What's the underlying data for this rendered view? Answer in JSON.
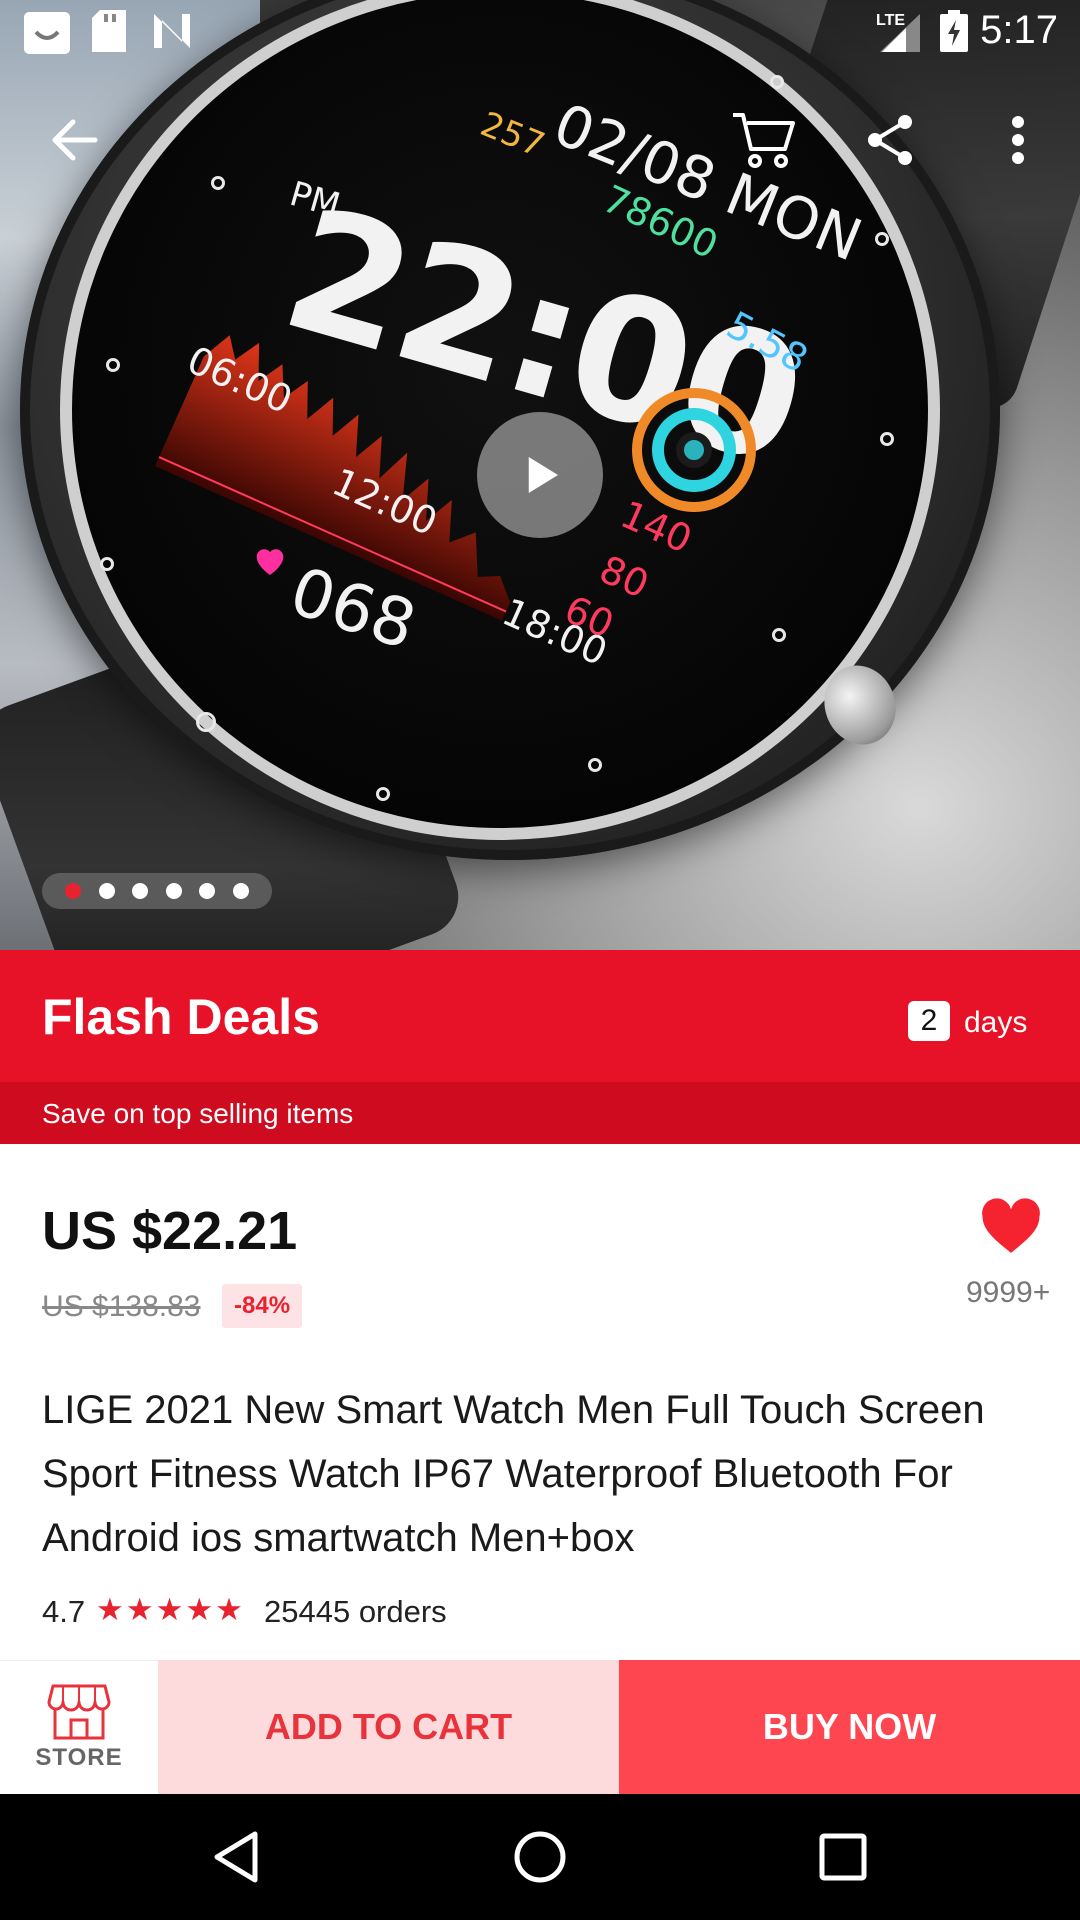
{
  "status_bar": {
    "time": "5:17",
    "network": "LTE",
    "icons": [
      "notification-app-icon",
      "sd-card-icon",
      "n-app-icon",
      "signal-icon",
      "battery-charging-icon"
    ]
  },
  "toolbar": {
    "icons": [
      "back-arrow-icon",
      "cart-icon",
      "share-icon",
      "more-vert-icon"
    ]
  },
  "hero": {
    "watch_face": {
      "date": "02/08 MON",
      "ampm": "PM",
      "time": "22:00",
      "calories": "257",
      "steps": "78600",
      "distance": "5.58",
      "times": [
        "06:00",
        "12:00",
        "18:00"
      ],
      "heart_scale": [
        "140",
        "80",
        "60"
      ],
      "heart_rate": "068"
    },
    "pager": {
      "count": 6,
      "active": 0
    }
  },
  "flash_deals": {
    "title": "Flash Deals",
    "days_count": "2",
    "days_label": "days",
    "subtitle": "Save on top selling items"
  },
  "product": {
    "price": "US $22.21",
    "original_price": "US $138.83",
    "discount": "-84%",
    "wishlist_count": "9999+",
    "title": "LIGE 2021 New Smart Watch Men Full Touch Screen Sport Fitness Watch IP67 Waterproof Bluetooth For Android ios smartwatch Men+box",
    "rating": "4.7",
    "stars": "★★★★★",
    "orders": "25445 orders"
  },
  "actions": {
    "store_label": "STORE",
    "add_to_cart": "ADD TO CART",
    "buy_now": "BUY NOW"
  },
  "colors": {
    "brand_red": "#e81228",
    "buy_red": "#fd4650",
    "cart_pink": "#fddbdc"
  }
}
